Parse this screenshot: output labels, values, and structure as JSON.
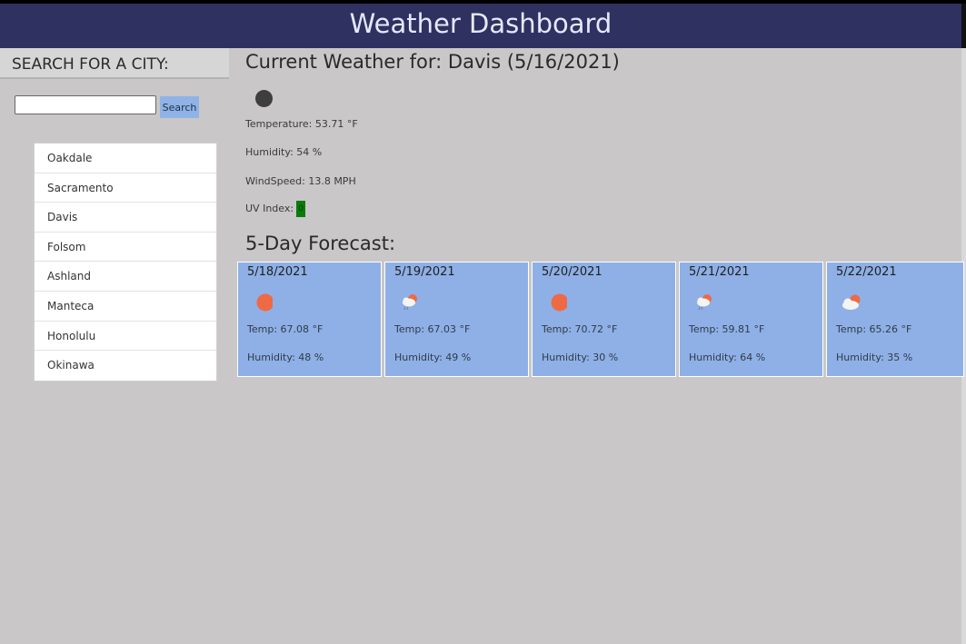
{
  "app": {
    "title": "Weather Dashboard"
  },
  "sidebar": {
    "title": "SEARCH FOR A CITY:",
    "search_value": "",
    "search_button_label": "Search",
    "cities": [
      "Oakdale",
      "Sacramento",
      "Davis",
      "Folsom",
      "Ashland",
      "Manteca",
      "Honolulu",
      "Okinawa"
    ]
  },
  "current": {
    "title": "Current Weather for: Davis (5/16/2021)",
    "icon": "dark-circle-icon",
    "temperature": "Temperature: 53.71 °F",
    "humidity": "Humidity: 54 %",
    "wind": "WindSpeed: 13.8 MPH",
    "uv_label": "UV Index:",
    "uv_value": "0",
    "uv_color": "#0a7a0a"
  },
  "forecast": {
    "title": "5-Day Forecast:",
    "days": [
      {
        "date": "5/18/2021",
        "icon": "sun-icon",
        "temp": "Temp: 67.08 °F",
        "humidity": "Humidity: 48 %"
      },
      {
        "date": "5/19/2021",
        "icon": "cloud-rain-sun-icon",
        "temp": "Temp: 67.03 °F",
        "humidity": "Humidity: 49 %"
      },
      {
        "date": "5/20/2021",
        "icon": "sun-icon",
        "temp": "Temp: 70.72 °F",
        "humidity": "Humidity: 30 %"
      },
      {
        "date": "5/21/2021",
        "icon": "cloud-rain-sun-icon",
        "temp": "Temp: 59.81 °F",
        "humidity": "Humidity: 64 %"
      },
      {
        "date": "5/22/2021",
        "icon": "cloud-sun-icon",
        "temp": "Temp: 65.26 °F",
        "humidity": "Humidity: 35 %"
      }
    ]
  },
  "colors": {
    "header_bg": "#2f3160",
    "page_bg": "#c9c7c8",
    "card_bg": "#8fb0e6",
    "button_bg": "#8fb3e6",
    "sun": "#ee6a44"
  }
}
